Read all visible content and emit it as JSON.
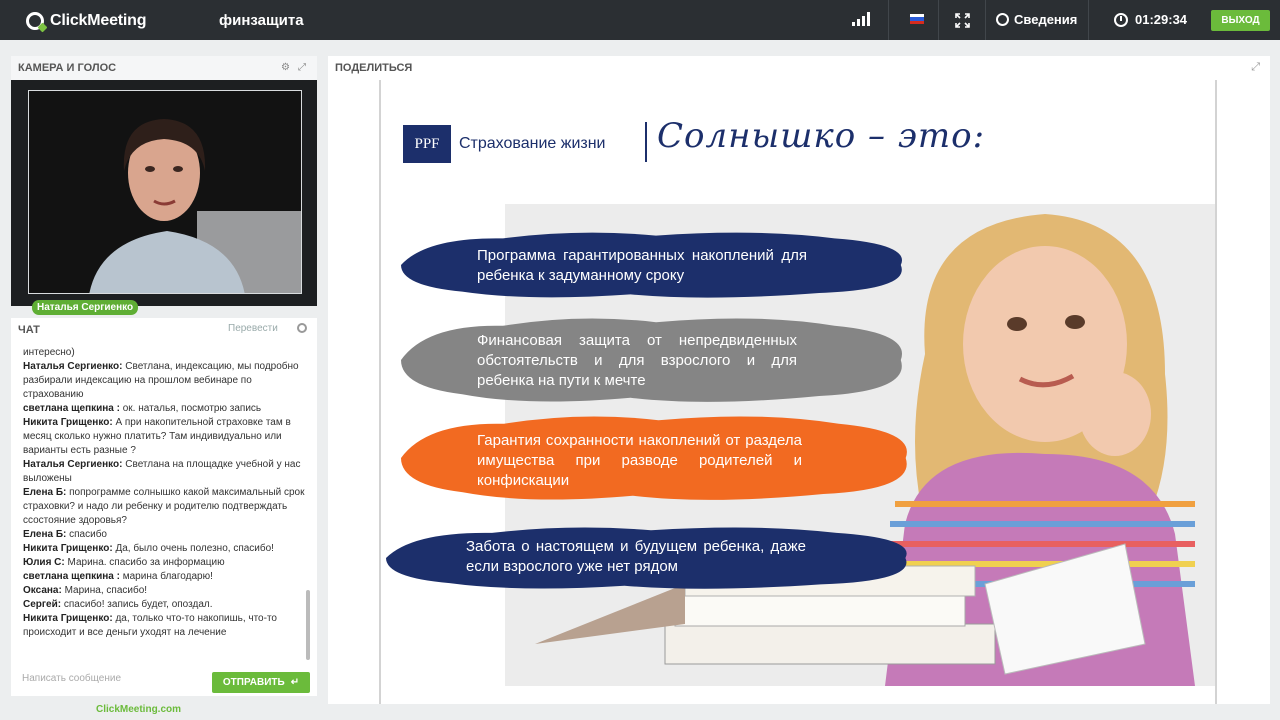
{
  "app": {
    "name": "ClickMeeting",
    "room_title": "финзащита"
  },
  "topbar": {
    "info_label": "Сведения",
    "timer": "01:29:34",
    "exit_label": "ВЫХОД"
  },
  "camera": {
    "header": "КАМЕРА И ГОЛОС",
    "presenter_name": "Наталья Сергиенко"
  },
  "chat": {
    "header": "ЧАТ",
    "translate_label": "Перевести",
    "input_placeholder": "Написать сообщение",
    "send_label": "ОТПРАВИТЬ",
    "messages": [
      {
        "author": "",
        "text": "интересно)"
      },
      {
        "author": "Наталья Сергиенко:",
        "text": "Светлана, индексацию, мы подробно разбирали индексацию на прошлом вебинаре по страхованию"
      },
      {
        "author": "светлана щепкина :",
        "text": "ок. наталья, посмотрю запись"
      },
      {
        "author": "Никита Грищенко:",
        "text": "А при накопительной страховке там в месяц сколько нужно платить? Там индивидуально или варианты есть разные ?"
      },
      {
        "author": "Наталья Сергиенко:",
        "text": "Светлана на площадке учебной у нас выложены"
      },
      {
        "author": "Елена Б:",
        "text": "попрограмме солнышко какой максимальный срок страховки? и надо ли ребенку и родителю подтверждать ссостояние здоровья?"
      },
      {
        "author": "Елена Б:",
        "text": "спасибо"
      },
      {
        "author": "Никита Грищенко:",
        "text": "Да, было очень полезно, спасибо!"
      },
      {
        "author": "Юлия С:",
        "text": "Марина. спасибо за информацию"
      },
      {
        "author": "светлана щепкина :",
        "text": "марина благодарю!"
      },
      {
        "author": "Оксана:",
        "text": "Марина, спасибо!"
      },
      {
        "author": "Сергей:",
        "text": "спасибо! запись будет, опоздал."
      },
      {
        "author": "Никита Грищенко:",
        "text": "да, только что-то накопишь, что-то происходит и все деньги уходят на лечение"
      }
    ]
  },
  "footer": {
    "link": "ClickMeeting.com"
  },
  "share": {
    "header": "ПОДЕЛИТЬСЯ",
    "slide": {
      "logo_mark": "PPF",
      "logo_text": "Страхование жизни",
      "title": "Солнышко  – это:",
      "bullets": [
        {
          "text": "Программа гарантированных накоплений для ребенка к задуманному сроку",
          "color": "#1c2f6b"
        },
        {
          "text": "Финансовая защита от непредвиденных обстоятельств и для взрослого и для ребенка на пути к мечте",
          "color": "#858585"
        },
        {
          "text": "Гарантия сохранности накоплений от раздела имущества при разводе родителей и конфискации",
          "color": "#f26a21"
        },
        {
          "text": "Забота о настоящем и будущем ребенка, даже если взрослого уже нет рядом",
          "color": "#1c2f6b"
        }
      ]
    }
  },
  "colors": {
    "topbar": "#2b2f33",
    "accent_green": "#6bbb3b",
    "navy": "#1c2f6b",
    "orange": "#f26a21"
  }
}
